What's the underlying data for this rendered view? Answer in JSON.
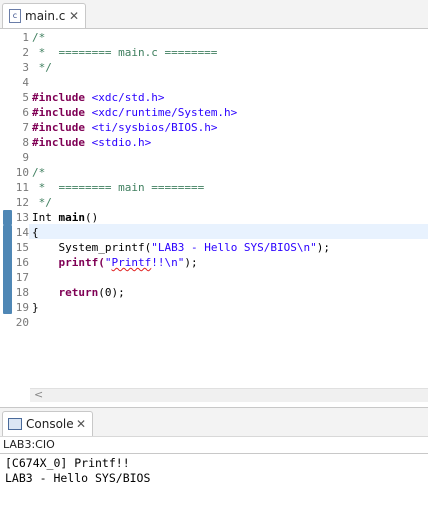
{
  "editor": {
    "tab_label": "main.c",
    "file_icon_letter": "c",
    "line_numbers": [
      "1",
      "2",
      "3",
      "4",
      "5",
      "6",
      "7",
      "8",
      "9",
      "10",
      "11",
      "12",
      "13",
      "14",
      "15",
      "16",
      "17",
      "18",
      "19",
      "20"
    ],
    "lines": {
      "l1": "/*",
      "l2": " *  ======== main.c ========",
      "l3": " */",
      "l5_kw": "#include",
      "l5_inc": " <xdc/std.h>",
      "l6_kw": "#include",
      "l6_inc": " <xdc/runtime/System.h>",
      "l7_kw": "#include",
      "l7_inc": " <ti/sysbios/BIOS.h>",
      "l8_kw": "#include",
      "l8_inc": " <stdio.h>",
      "l10": "/*",
      "l11": " *  ======== main ========",
      "l12": " */",
      "l13_type": "Int",
      "l13_name": "main",
      "l13_rest": "()",
      "l14": "{",
      "l15_fn": "    System_printf(",
      "l15_str": "\"LAB3 - Hello SYS/BIOS\\n\"",
      "l15_end": ");",
      "l16_fn": "    printf(",
      "l16_q": "\"",
      "l16_sq": "Printf",
      "l16_str_rest": "!!\\n\"",
      "l16_end": ");",
      "l18_kw": "    return",
      "l18_rest": "(0);",
      "l19": "}"
    }
  },
  "console": {
    "tab_label": "Console",
    "name": "LAB3:CIO",
    "output": [
      "[C674X_0] Printf!!",
      "LAB3 - Hello SYS/BIOS"
    ]
  },
  "scrollbar": {
    "left_arrow": "<"
  },
  "icons": {
    "close": "✕"
  }
}
